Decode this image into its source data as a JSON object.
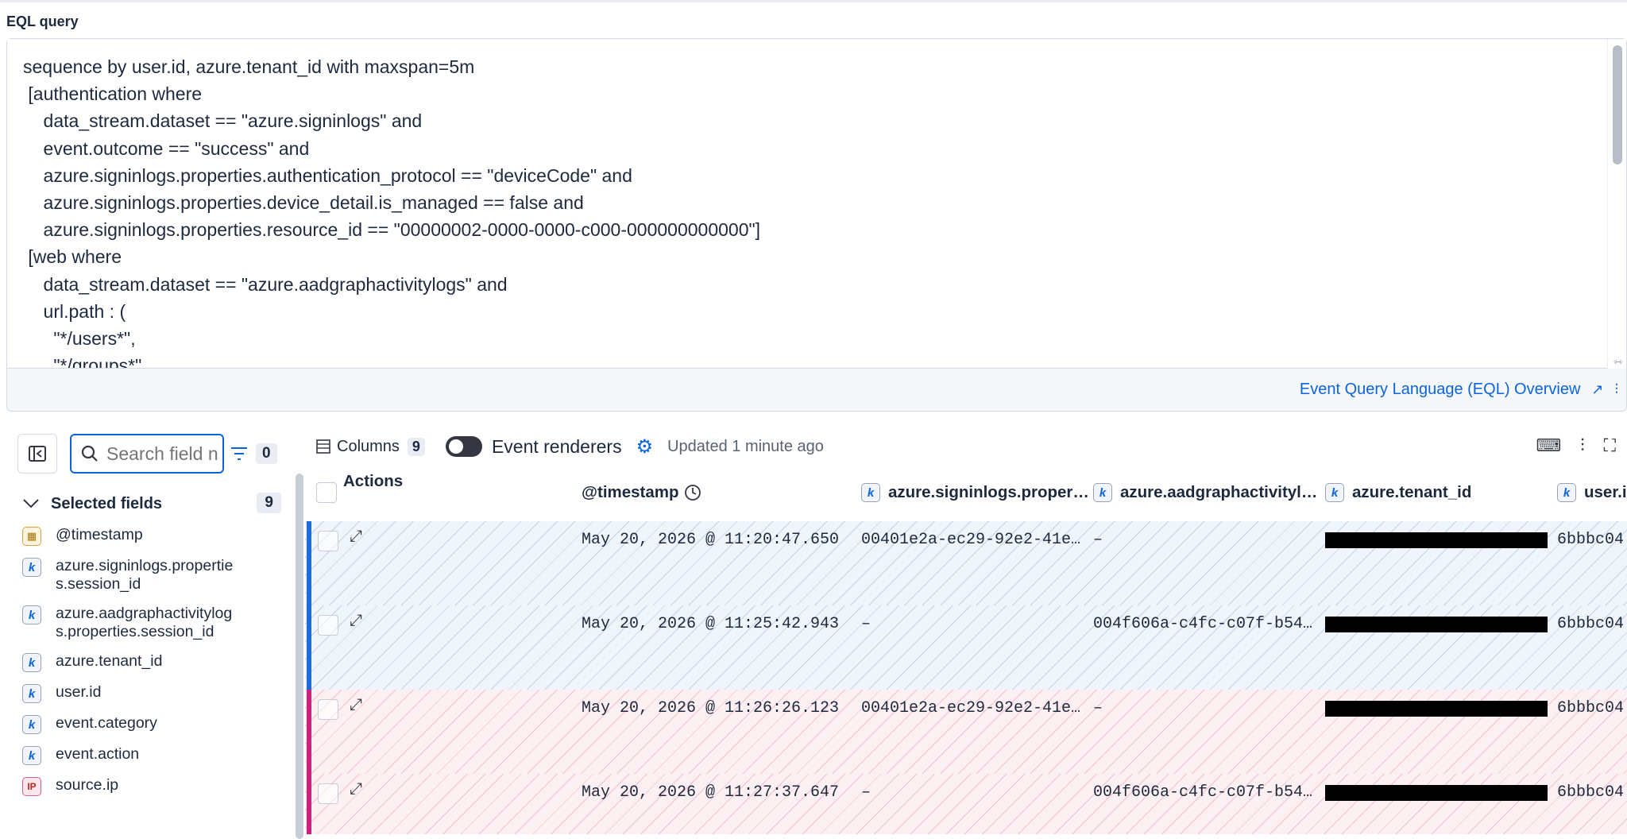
{
  "eql": {
    "label": "EQL query",
    "lines": [
      "sequence by user.id, azure.tenant_id with maxspan=5m",
      " [authentication where",
      "    data_stream.dataset == \"azure.signinlogs\" and",
      "    event.outcome == \"success\" and",
      "    azure.signinlogs.properties.authentication_protocol == \"deviceCode\" and",
      "    azure.signinlogs.properties.device_detail.is_managed == false and",
      "    azure.signinlogs.properties.resource_id == \"00000002-0000-0000-c000-000000000000\"]",
      " [web where",
      "    data_stream.dataset == \"azure.aadgraphactivitylogs\" and",
      "    url.path : (",
      "      \"*/users*\",",
      "      \"*/groups*\""
    ],
    "overview_link": "Event Query Language (EQL) Overview"
  },
  "sidebar": {
    "search_placeholder": "Search field names",
    "filter_count": "0",
    "selected_title": "Selected fields",
    "selected_count": "9",
    "fields": [
      {
        "type": "date",
        "badge": "▦",
        "name": "@timestamp"
      },
      {
        "type": "keyword",
        "badge": "k",
        "name": "azure.signinlogs.properties.session_id"
      },
      {
        "type": "keyword",
        "badge": "k",
        "name": "azure.aadgraphactivitylogs.properties.session_id"
      },
      {
        "type": "keyword",
        "badge": "k",
        "name": "azure.tenant_id"
      },
      {
        "type": "keyword",
        "badge": "k",
        "name": "user.id"
      },
      {
        "type": "keyword",
        "badge": "k",
        "name": "event.category"
      },
      {
        "type": "keyword",
        "badge": "k",
        "name": "event.action"
      },
      {
        "type": "ip",
        "badge": "IP",
        "name": "source.ip"
      }
    ]
  },
  "toolbar": {
    "columns_label": "Columns",
    "columns_count": "9",
    "renderers_label": "Event renderers",
    "updated": "Updated 1 minute ago"
  },
  "grid": {
    "headers": {
      "actions": "Actions",
      "timestamp": "@timestamp",
      "col1": "azure.signinlogs.proper…",
      "col2": "azure.aadgraphactivityl…",
      "col3": "azure.tenant_id",
      "col4": "user.i"
    },
    "rows": [
      {
        "style": "blue",
        "timestamp": "May 20, 2026 @ 11:20:47.650",
        "signin": "00401e2a-ec29-92e2-41e…",
        "aad": "–",
        "user": "6bbbc04"
      },
      {
        "style": "blue",
        "timestamp": "May 20, 2026 @ 11:25:42.943",
        "signin": "–",
        "aad": "004f606a-c4fc-c07f-b54…",
        "user": "6bbbc04"
      },
      {
        "style": "pink",
        "timestamp": "May 20, 2026 @ 11:26:26.123",
        "signin": "00401e2a-ec29-92e2-41e…",
        "aad": "–",
        "user": "6bbbc04"
      },
      {
        "style": "pink",
        "timestamp": "May 20, 2026 @ 11:27:37.647",
        "signin": "–",
        "aad": "004f606a-c4fc-c07f-b54…",
        "user": "6bbbc04"
      }
    ]
  }
}
